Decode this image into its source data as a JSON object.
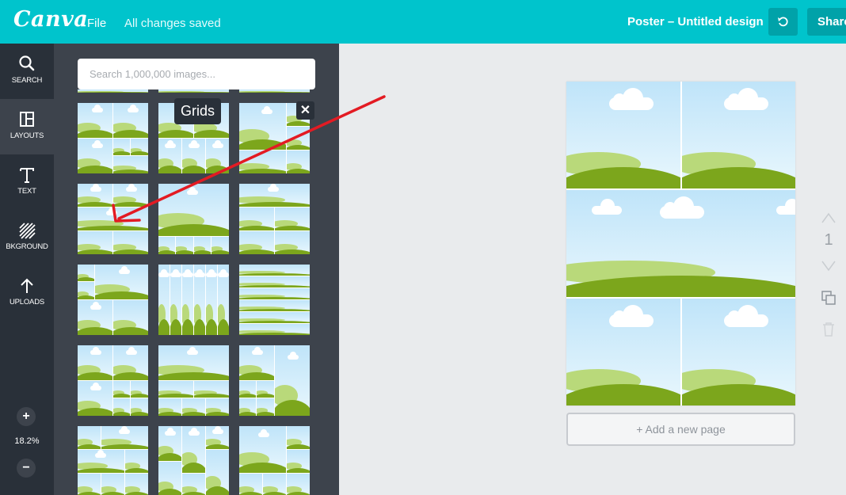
{
  "topbar": {
    "logo_text": "Canva",
    "file_menu": "File",
    "save_status": "All changes saved",
    "design_title": "Poster – Untitled design",
    "undo_icon": "undo-icon",
    "share_label": "Share",
    "brand_color": "#00c4cc"
  },
  "leftnav": {
    "items": [
      {
        "label": "SEARCH",
        "icon": "search-icon"
      },
      {
        "label": "LAYOUTS",
        "icon": "layouts-icon"
      },
      {
        "label": "TEXT",
        "icon": "text-icon"
      },
      {
        "label": "BKGROUND",
        "icon": "background-icon"
      },
      {
        "label": "UPLOADS",
        "icon": "upload-icon"
      }
    ],
    "zoom_in_label": "+",
    "zoom_level": "18.2%",
    "zoom_out_label": "−"
  },
  "panel": {
    "search_placeholder": "Search 1,000,000 images...",
    "tooltip": "Grids",
    "close_label": "✕"
  },
  "canvas": {
    "add_page_label": "+ Add a new page",
    "page_number": "1"
  }
}
